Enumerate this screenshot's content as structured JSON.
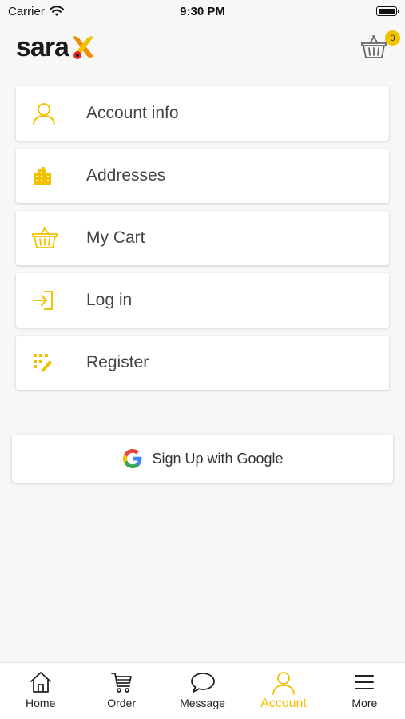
{
  "status_bar": {
    "carrier": "Carrier",
    "time": "9:30 PM"
  },
  "header": {
    "logo_text": "sara",
    "logo_letter": "X",
    "cart_count": "0"
  },
  "colors": {
    "accent": "#f2c200",
    "logo_orange": "#f28c00",
    "logo_red": "#e8272a",
    "google_blue": "#4285F4"
  },
  "menu": {
    "items": [
      {
        "label": "Account info",
        "icon": "user-icon"
      },
      {
        "label": "Addresses",
        "icon": "building-icon"
      },
      {
        "label": "My Cart",
        "icon": "basket-icon"
      },
      {
        "label": "Log in",
        "icon": "login-icon"
      },
      {
        "label": "Register",
        "icon": "register-icon"
      }
    ]
  },
  "google": {
    "label": "Sign Up with Google"
  },
  "tabs": [
    {
      "label": "Home",
      "icon": "home-icon"
    },
    {
      "label": "Order",
      "icon": "cart-icon"
    },
    {
      "label": "Message",
      "icon": "message-icon"
    },
    {
      "label": "Account",
      "icon": "user-icon",
      "active": true
    },
    {
      "label": "More",
      "icon": "menu-icon"
    }
  ]
}
